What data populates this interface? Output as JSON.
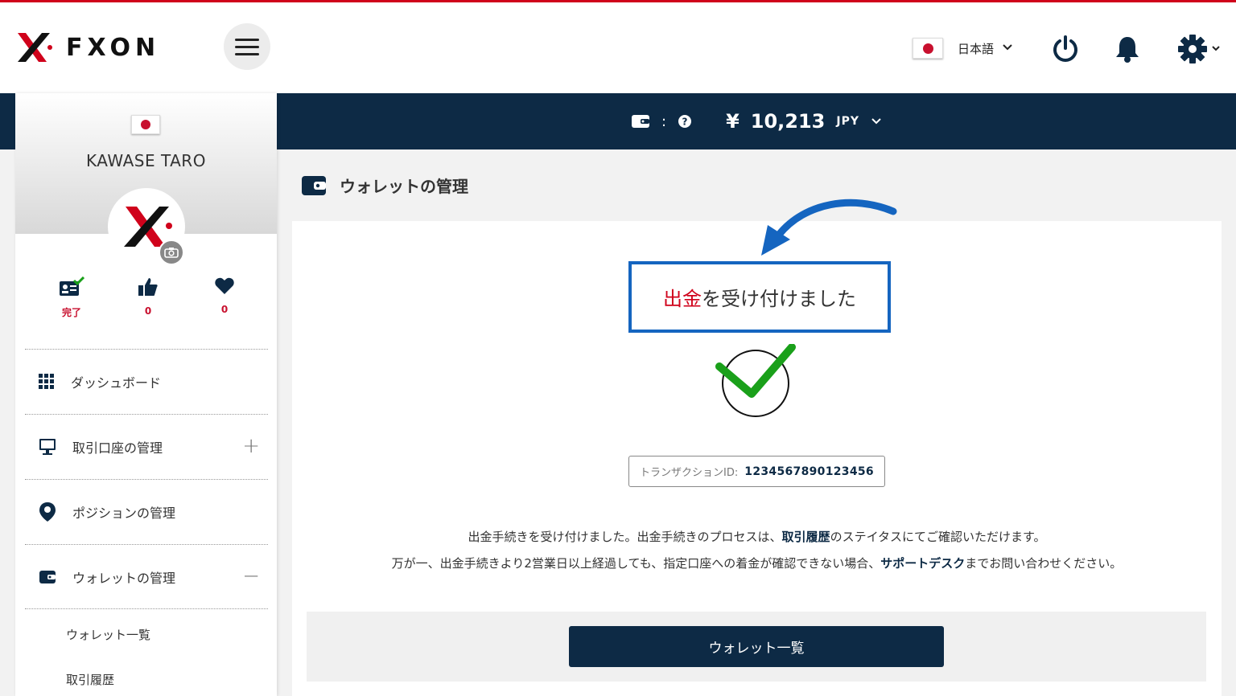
{
  "header": {
    "logo_text": "FXON",
    "language": "日本語",
    "icons": [
      "menu-icon",
      "power-icon",
      "bell-icon",
      "gear-icon"
    ]
  },
  "balance": {
    "separator": ":",
    "currency_symbol": "¥",
    "amount": "10,213",
    "currency": "JPY"
  },
  "sidebar": {
    "user_name": "KAWASE TARO",
    "stats": [
      {
        "icon": "id-card-check-icon",
        "value": "完了"
      },
      {
        "icon": "thumbs-up-icon",
        "value": "0"
      },
      {
        "icon": "heart-icon",
        "value": "0"
      }
    ],
    "items": [
      {
        "label": "ダッシュボード",
        "icon": "grid-icon",
        "toggle": ""
      },
      {
        "label": "取引口座の管理",
        "icon": "monitor-icon",
        "toggle": "+"
      },
      {
        "label": "ポジションの管理",
        "icon": "map-pin-icon",
        "toggle": ""
      },
      {
        "label": "ウォレットの管理",
        "icon": "wallet-icon",
        "toggle": "−"
      }
    ],
    "sub_items": [
      {
        "label": "ウォレット一覧"
      },
      {
        "label": "取引履歴"
      }
    ]
  },
  "main": {
    "title": "ウォレットの管理",
    "message_red": "出金",
    "message_rest": "を受け付けました",
    "transaction_label": "トランザクションID:",
    "transaction_id": "1234567890123456",
    "info_line1_a": "出金手続きを受け付けました。出金手続きのプロセスは、",
    "info_line1_link": "取引履歴",
    "info_line1_b": "のステイタスにてご確認いただけます。",
    "info_line2_a": "万が一、出金手続きより2営業日以上経過しても、指定口座への着金が確認できない場合、",
    "info_line2_link": "サポートデスク",
    "info_line2_b": "までお問い合わせください。",
    "button_label": "ウォレット一覧"
  },
  "colors": {
    "navy": "#0d2a45",
    "red": "#d0021b",
    "blue_frame": "#1565c0",
    "check_green": "#1aa01a"
  }
}
